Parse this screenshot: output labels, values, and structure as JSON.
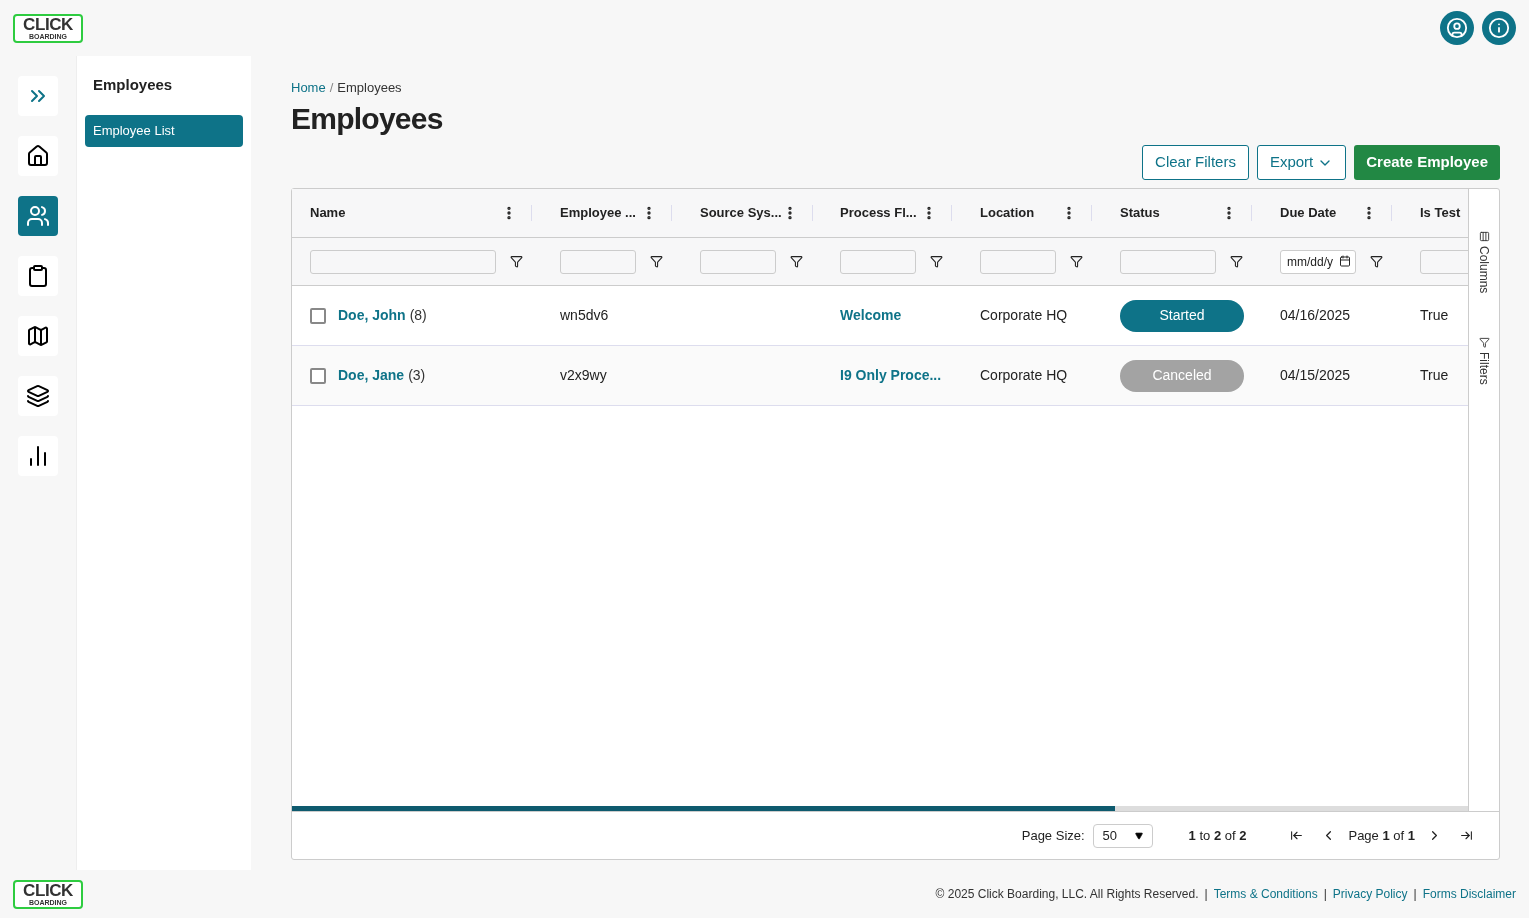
{
  "header_logo": {
    "word": "CLICK",
    "tagline": "BOARDING"
  },
  "rail": [
    {
      "selected": false
    },
    {
      "selected": false
    },
    {
      "selected": true
    },
    {
      "selected": false
    },
    {
      "selected": false
    },
    {
      "selected": false
    },
    {
      "selected": false
    }
  ],
  "subnav": {
    "title": "Employees",
    "items": [
      {
        "label": "Employee List",
        "selected": true
      }
    ]
  },
  "breadcrumb": {
    "items": [
      "Home",
      "Employees"
    ],
    "separator": "/"
  },
  "page_title": "Employees",
  "actions": [
    {
      "label": "Clear Filters",
      "kind": "outline"
    },
    {
      "label": "Export",
      "kind": "dropdown"
    },
    {
      "label": "Create Employee",
      "kind": "primary"
    }
  ],
  "table": {
    "columns": [
      {
        "label": "Name"
      },
      {
        "label": "Employee ..."
      },
      {
        "label": "Source Sys..."
      },
      {
        "label": "Process Fl..."
      },
      {
        "label": "Location"
      },
      {
        "label": "Status"
      },
      {
        "label": "Due Date",
        "placeholder": "mm/dd/y"
      },
      {
        "label": "Is Test"
      }
    ],
    "rows": [
      {
        "checked": false,
        "name": "Doe, John",
        "count": "(8)",
        "employee": "wn5dv6",
        "process": "Welcome",
        "location": "Corporate HQ",
        "status": {
          "label": "Started",
          "color": "#0e7388"
        },
        "due": "04/16/2025",
        "is_test": "True"
      },
      {
        "checked": false,
        "name": "Doe, Jane",
        "count": "(3)",
        "employee": "v2x9wy",
        "process": "I9 Only Proce...",
        "location": "Corporate HQ",
        "status": {
          "label": "Canceled",
          "color": "#a3a3a3"
        },
        "due": "04/15/2025",
        "is_test": "True"
      }
    ],
    "side_tabs": [
      "Columns",
      "Filters"
    ],
    "pagination": {
      "page_size_label": "Page Size:",
      "page_size": "50",
      "range": "**1** to **2** of **2**",
      "page": "Page **1** of **1**"
    }
  },
  "footer": {
    "logo": {
      "word": "CLICK",
      "tagline": "BOARDING"
    },
    "copyright": "© 2025 Click Boarding, LLC. All Rights Reserved.",
    "links": [
      {
        "separator": "|",
        "label": "Terms & Conditions"
      },
      {
        "separator": "|",
        "label": "Privacy Policy"
      },
      {
        "separator": "|",
        "label": "Forms Disclaimer"
      }
    ]
  }
}
